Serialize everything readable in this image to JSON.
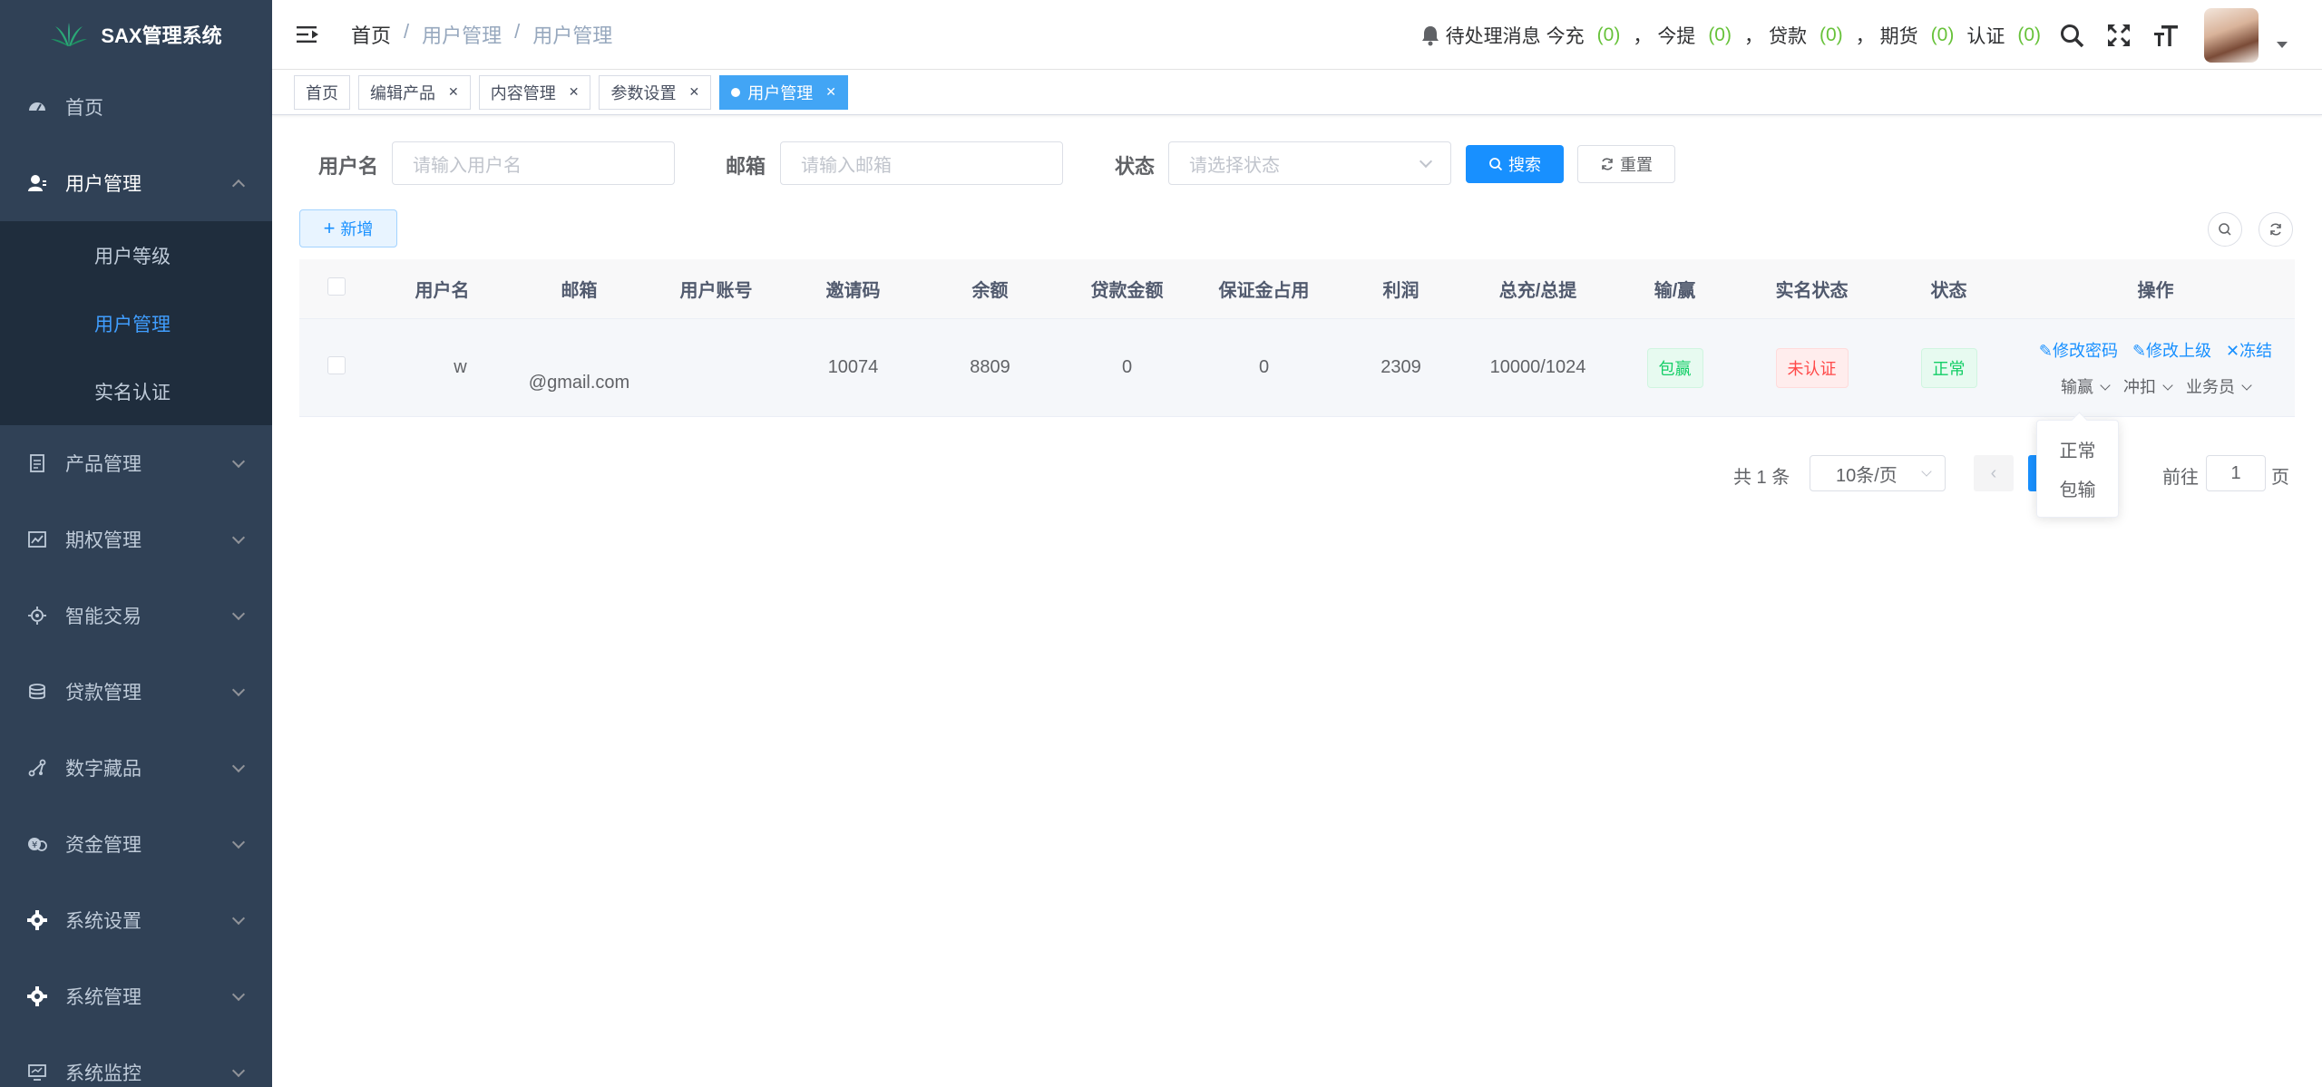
{
  "app": {
    "title": "SAX管理系统"
  },
  "colors": {
    "primary": "#1890ff",
    "sidebar_bg": "#304156",
    "submenu_bg": "#1f2d3d",
    "success": "#13ce66",
    "danger": "#ff4949",
    "count": "#67c23a"
  },
  "sidebar": {
    "items": [
      {
        "label": "首页",
        "icon": "dashboard-icon"
      },
      {
        "label": "用户管理",
        "icon": "user-icon",
        "open": true,
        "children": [
          {
            "label": "用户等级"
          },
          {
            "label": "用户管理",
            "active": true
          },
          {
            "label": "实名认证"
          }
        ]
      },
      {
        "label": "产品管理",
        "icon": "document-icon"
      },
      {
        "label": "期权管理",
        "icon": "chart-icon"
      },
      {
        "label": "智能交易",
        "icon": "chip-icon"
      },
      {
        "label": "贷款管理",
        "icon": "coins-icon"
      },
      {
        "label": "数字藏品",
        "icon": "nodes-icon"
      },
      {
        "label": "资金管理",
        "icon": "money-icon"
      },
      {
        "label": "系统设置",
        "icon": "gear-icon"
      },
      {
        "label": "系统管理",
        "icon": "gear-icon"
      },
      {
        "label": "系统监控",
        "icon": "monitor-icon"
      }
    ]
  },
  "header": {
    "breadcrumb": [
      "首页",
      "用户管理",
      "用户管理"
    ],
    "notices": {
      "label": "待处理消息",
      "items": [
        {
          "label": "今充",
          "count": "(0)"
        },
        {
          "label": "今提",
          "count": "(0)"
        },
        {
          "label": "贷款",
          "count": "(0)"
        },
        {
          "label": "期货",
          "count": "(0)"
        },
        {
          "label": "认证",
          "count": "(0)"
        }
      ],
      "separator": "，"
    }
  },
  "tags": [
    {
      "label": "首页",
      "closable": false
    },
    {
      "label": "编辑产品",
      "closable": true
    },
    {
      "label": "内容管理",
      "closable": true
    },
    {
      "label": "参数设置",
      "closable": true
    },
    {
      "label": "用户管理",
      "closable": true,
      "active": true
    }
  ],
  "filter": {
    "username": {
      "label": "用户名",
      "placeholder": "请输入用户名"
    },
    "email": {
      "label": "邮箱",
      "placeholder": "请输入邮箱"
    },
    "status": {
      "label": "状态",
      "placeholder": "请选择状态"
    },
    "search_label": "搜索",
    "reset_label": "重置"
  },
  "toolbar": {
    "add_label": "新增"
  },
  "table": {
    "columns": [
      "用户名",
      "邮箱",
      "用户账号",
      "邀请码",
      "余额",
      "贷款金额",
      "保证金占用",
      "利润",
      "总充/总提",
      "输/赢",
      "实名状态",
      "状态",
      "操作"
    ],
    "rows": [
      {
        "username": "w",
        "email": "@gmail.com",
        "account": "",
        "invite_code": "10074",
        "balance": "8809",
        "loan": "0",
        "margin": "0",
        "profit": "2309",
        "recharge_withdraw": "10000/1024",
        "win_lose": "包赢",
        "realname": "未认证",
        "status": "正常",
        "ops": {
          "change_password": "修改密码",
          "change_superior": "修改上级",
          "freeze": "冻结",
          "win_lose_menu": "输赢",
          "deduct_menu": "冲扣",
          "salesman_menu": "业务员"
        }
      }
    ]
  },
  "pagination": {
    "total": "共 1 条",
    "page_size": "10条/页",
    "goto_label": "前往",
    "goto_value": "1",
    "page_suffix": "页"
  },
  "dropdown_menu": {
    "items": [
      "正常",
      "包输"
    ]
  }
}
